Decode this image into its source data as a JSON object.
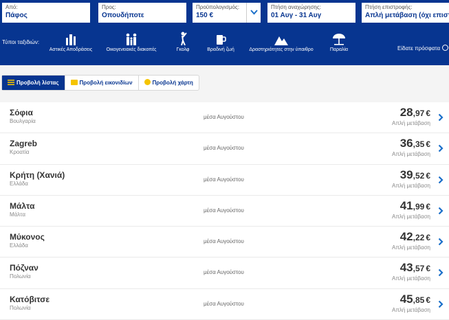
{
  "search": {
    "from": {
      "label": "Από:",
      "value": "Πάφος"
    },
    "to": {
      "label": "Προς:",
      "value": "Οπουδήποτε"
    },
    "budget": {
      "label": "Προϋπολογισμός:",
      "value": "150 €"
    },
    "departure": {
      "label": "Πτήση αναχώρησης:",
      "value": "01 Αυγ - 31 Αυγ"
    },
    "return": {
      "label": "Πτήση επιστροφής:",
      "value": "Απλή μετάβαση (όχι επιστρο"
    }
  },
  "trip_types": {
    "label": "Τύποι ταξιδιών:",
    "items": [
      {
        "label": "Αστικές Αποδράσεις",
        "icon": "city-icon"
      },
      {
        "label": "Οικογενειακές διακοπές",
        "icon": "family-icon"
      },
      {
        "label": "Γκολφ",
        "icon": "golf-icon"
      },
      {
        "label": "Βραδινή ζωή",
        "icon": "nightlife-icon"
      },
      {
        "label": "Δραστηριότητες στην ύπαιθρο",
        "icon": "mountain-icon"
      },
      {
        "label": "Παραλία",
        "icon": "beach-icon"
      }
    ]
  },
  "recently_seen": "Είδατε πρόσφατα",
  "views": [
    {
      "label": "Προβολή λίστας",
      "active": true
    },
    {
      "label": "Προβολή εικονιδίων",
      "active": false
    },
    {
      "label": "Προβολή χάρτη",
      "active": false
    }
  ],
  "results": [
    {
      "city": "Σόφια",
      "country": "Βουλγαρία",
      "when": "μέσα Αυγούστου",
      "price_int": "28",
      "price_dec": ",97",
      "currency": "€",
      "trip": "Απλή μετάβαση"
    },
    {
      "city": "Zagreb",
      "country": "Κροατία",
      "when": "μέσα Αυγούστου",
      "price_int": "36",
      "price_dec": ",35",
      "currency": "€",
      "trip": "Απλή μετάβαση"
    },
    {
      "city": "Κρήτη (Χανιά)",
      "country": "Ελλάδα",
      "when": "μέσα Αυγούστου",
      "price_int": "39",
      "price_dec": ",52",
      "currency": "€",
      "trip": "Απλή μετάβαση"
    },
    {
      "city": "Μάλτα",
      "country": "Μάλτα",
      "when": "μέσα Αυγούστου",
      "price_int": "41",
      "price_dec": ",99",
      "currency": "€",
      "trip": "Απλή μετάβαση"
    },
    {
      "city": "Μύκονος",
      "country": "Ελλάδα",
      "when": "μέσα Αυγούστου",
      "price_int": "42",
      "price_dec": ",22",
      "currency": "€",
      "trip": "Απλή μετάβαση"
    },
    {
      "city": "Πόζναν",
      "country": "Πολωνία",
      "when": "μέσα Αυγούστου",
      "price_int": "43",
      "price_dec": ",57",
      "currency": "€",
      "trip": "Απλή μετάβαση"
    },
    {
      "city": "Κατόβιτσε",
      "country": "Πολωνία",
      "when": "μέσα Αυγούστου",
      "price_int": "45",
      "price_dec": ",85",
      "currency": "€",
      "trip": "Απλή μετάβαση"
    }
  ],
  "colors": {
    "brand": "#073590",
    "accent": "#1a6fc9",
    "active_view": "#073590"
  }
}
